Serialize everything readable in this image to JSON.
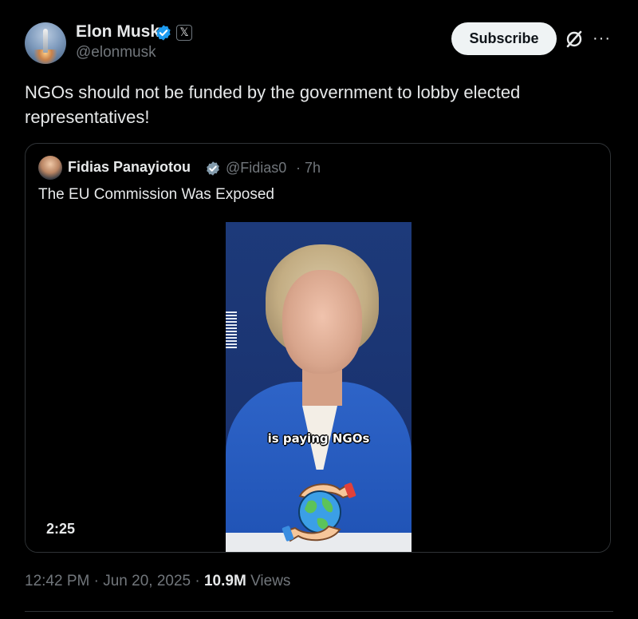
{
  "author": {
    "name": "Elon Musk",
    "handle": "@elonmusk",
    "badge_label": "𝕏",
    "verified_color": "#1d9bf0"
  },
  "actions": {
    "subscribe_label": "Subscribe",
    "grok_icon": "grok-slash-circle-icon",
    "more_icon": "ellipsis-icon",
    "more_label": "···"
  },
  "tweet": {
    "text": "NGOs should not be funded by the government to lobby elected representatives!"
  },
  "quote": {
    "author_name": "Fidias Panayiotou",
    "handle": "@Fidias0",
    "separator": "·",
    "time": "7h",
    "text": "The EU Commission Was Exposed",
    "verified_color": "#829aab",
    "video": {
      "caption": "is paying NGOs",
      "duration": "2:25"
    }
  },
  "footer": {
    "time": "12:42 PM",
    "separator": "·",
    "date": "Jun 20, 2025",
    "separator2": "·",
    "views_count": "10.9M",
    "views_label": "Views"
  }
}
